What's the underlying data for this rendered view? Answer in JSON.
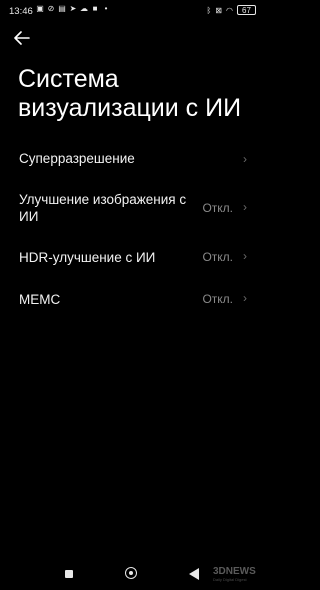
{
  "status_bar": {
    "time": "13:46",
    "left_icons": [
      "image-icon",
      "alarm-off-icon",
      "n-badge-icon",
      "telegram-icon",
      "cloud-icon",
      "square-app-icon",
      "dot-icon"
    ],
    "right_icons": [
      "bluetooth-icon",
      "mute-icon",
      "wifi-icon"
    ],
    "battery": "67"
  },
  "header": {
    "title": "Система визуализации с ИИ"
  },
  "settings": {
    "items": [
      {
        "label": "Суперразрешение",
        "value": ""
      },
      {
        "label": "Улучшение изображения с ИИ",
        "value": "Откл."
      },
      {
        "label": "HDR-улучшение с ИИ",
        "value": "Откл."
      },
      {
        "label": "MEMC",
        "value": "Откл."
      }
    ]
  },
  "watermark": {
    "logo": "3DNEWS",
    "tagline": "Daily Digital Digest"
  },
  "colors": {
    "background": "#000000",
    "text_primary": "#f2f2f2",
    "text_secondary": "#8a8a8a"
  }
}
